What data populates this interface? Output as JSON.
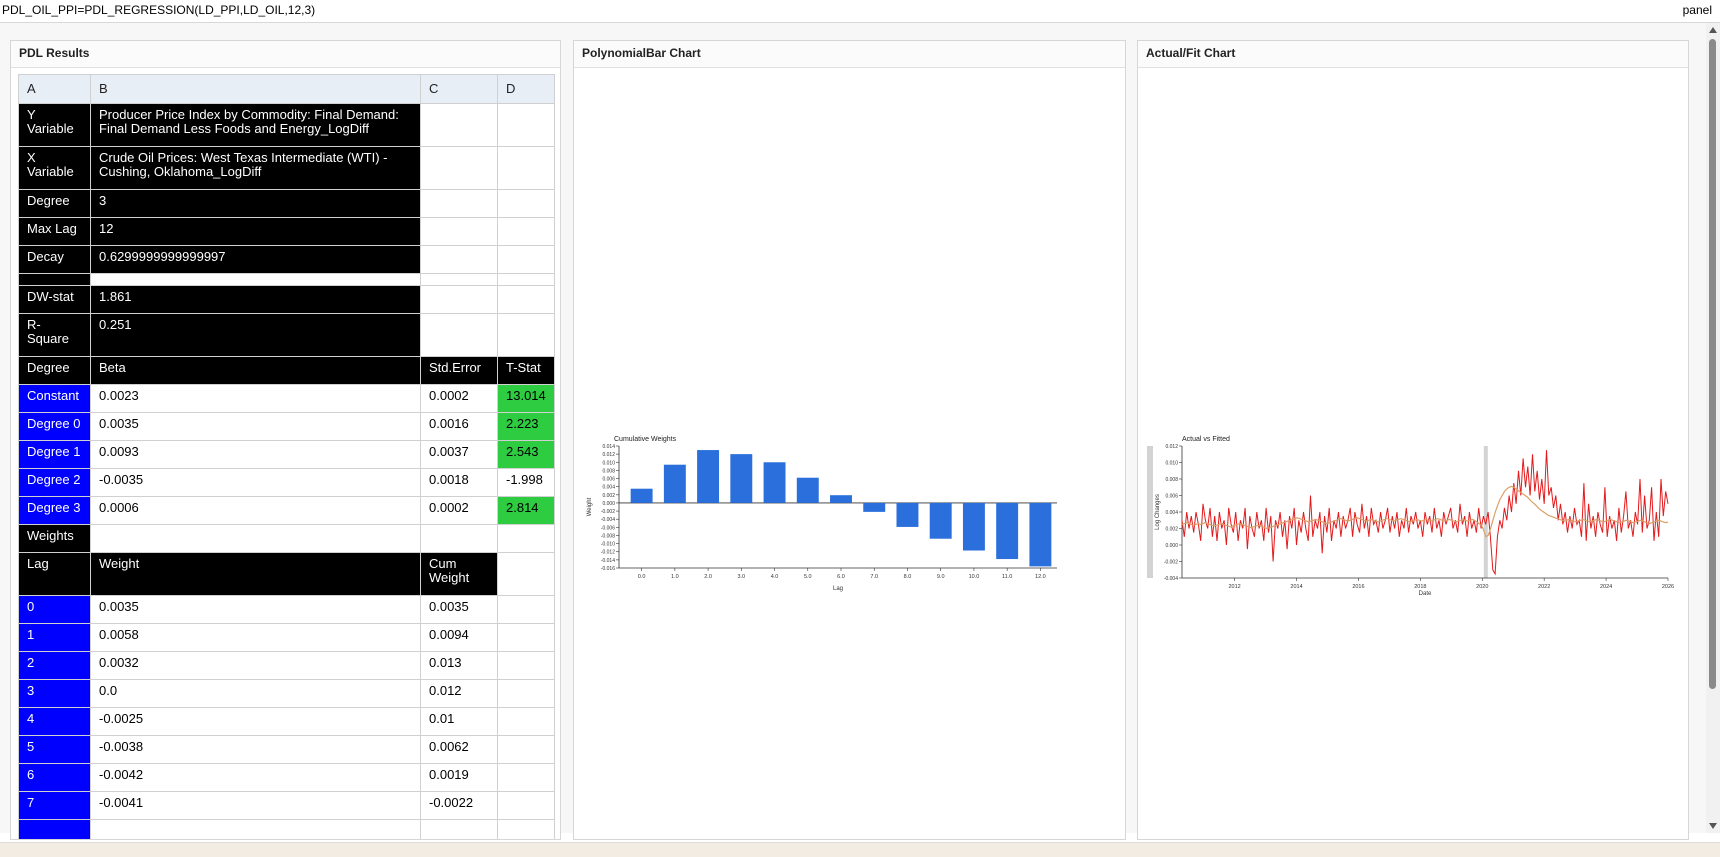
{
  "formula": "PDL_OIL_PPI=PDL_REGRESSION(LD_PPI,LD_OIL,12,3)",
  "panel_tag": "panel",
  "panels": {
    "results": "PDL Results",
    "poly": "PolynomialBar Chart",
    "fit": "Actual/Fit Chart"
  },
  "table": {
    "columns": [
      "A",
      "B",
      "C",
      "D"
    ],
    "y_variable": {
      "label": "Y Variable",
      "value": "Producer Price Index by Commodity: Final Demand: Final Demand Less Foods and Energy_LogDiff"
    },
    "x_variable": {
      "label": "X Variable",
      "value": "Crude Oil Prices: West Texas Intermediate (WTI) - Cushing, Oklahoma_LogDiff"
    },
    "degree": {
      "label": "Degree",
      "value": "3"
    },
    "max_lag": {
      "label": "Max Lag",
      "value": "12"
    },
    "decay": {
      "label": "Decay",
      "value": "0.6299999999999997"
    },
    "dw": {
      "label": "DW-stat",
      "value": "1.861"
    },
    "r2": {
      "label": "R-Square",
      "value": "0.251"
    },
    "coef_header": [
      "Degree",
      "Beta",
      "Std.Error",
      "T-Stat"
    ],
    "coefs": [
      {
        "name": "Constant",
        "beta": "0.0023",
        "se": "0.0002",
        "t": "13.014",
        "sig": true
      },
      {
        "name": "Degree 0",
        "beta": "0.0035",
        "se": "0.0016",
        "t": "2.223",
        "sig": true
      },
      {
        "name": "Degree 1",
        "beta": "0.0093",
        "se": "0.0037",
        "t": "2.543",
        "sig": true
      },
      {
        "name": "Degree 2",
        "beta": "-0.0035",
        "se": "0.0018",
        "t": "-1.998",
        "sig": false
      },
      {
        "name": "Degree 3",
        "beta": "0.0006",
        "se": "0.0002",
        "t": "2.814",
        "sig": true
      }
    ],
    "weights_label": "Weights",
    "weights_header": [
      "Lag",
      "Weight",
      "Cum Weight"
    ],
    "weights": [
      {
        "lag": "0",
        "w": "0.0035",
        "cum": "0.0035"
      },
      {
        "lag": "1",
        "w": "0.0058",
        "cum": "0.0094"
      },
      {
        "lag": "2",
        "w": "0.0032",
        "cum": "0.013"
      },
      {
        "lag": "3",
        "w": "0.0",
        "cum": "0.012"
      },
      {
        "lag": "4",
        "w": "-0.0025",
        "cum": "0.01"
      },
      {
        "lag": "5",
        "w": "-0.0038",
        "cum": "0.0062"
      },
      {
        "lag": "6",
        "w": "-0.0042",
        "cum": "0.0019"
      },
      {
        "lag": "7",
        "w": "-0.0041",
        "cum": "-0.0022"
      }
    ]
  },
  "colors": {
    "black": "#000000",
    "blue": "#0000ff",
    "green": "#2ecc40",
    "bar": "#2a6fdb",
    "actual": "#e31a1c",
    "fitted": "#d9a066"
  },
  "chart_data": [
    {
      "type": "bar",
      "title": "Cumulative Weights",
      "xlabel": "Lag",
      "ylabel": "Weight",
      "categories": [
        "0.0",
        "1.0",
        "2.0",
        "3.0",
        "4.0",
        "5.0",
        "6.0",
        "7.0",
        "8.0",
        "9.0",
        "10.0",
        "11.0",
        "12.0"
      ],
      "values": [
        0.0035,
        0.0094,
        0.013,
        0.012,
        0.01,
        0.0062,
        0.0019,
        -0.0022,
        -0.0059,
        -0.0088,
        -0.0117,
        -0.0138,
        -0.0156
      ],
      "ylim": [
        -0.016,
        0.014
      ],
      "yticks": [
        "0.014",
        "0.012",
        "0.010",
        "0.008",
        "0.006",
        "0.004",
        "0.002",
        "0.000",
        "-0.002",
        "-0.004",
        "-0.006",
        "-0.008",
        "-0.010",
        "-0.012",
        "-0.014",
        "-0.016"
      ]
    },
    {
      "type": "line",
      "title": "Actual vs Fitted",
      "xlabel": "Date",
      "ylabel": "Log Changes",
      "xlim": [
        2010.3,
        2026
      ],
      "ylim": [
        -0.004,
        0.012
      ],
      "xticks": [
        "2012",
        "2014",
        "2016",
        "2018",
        "2020",
        "2022",
        "2024",
        "2026"
      ],
      "yticks": [
        "0.012",
        "0.010",
        "0.008",
        "0.006",
        "0.004",
        "0.002",
        "0.000",
        "-0.002",
        "-0.004"
      ],
      "series": [
        {
          "name": "Actual",
          "values": [
            0.003,
            0.001,
            0.004,
            0.002,
            0.0035,
            0.0015,
            0.004,
            0.0025,
            0.0005,
            0.005,
            0.003,
            0.002,
            0.0045,
            0.001,
            0.0035,
            0.0005,
            0.004,
            0.002,
            0.003,
            0.0,
            0.0045,
            0.0025,
            0.0015,
            0.004,
            0.0005,
            0.003,
            0.002,
            0.0045,
            -0.0005,
            0.0035,
            0.002,
            0.001,
            0.004,
            0.002,
            0.003,
            0.0005,
            0.0045,
            0.0015,
            0.0035,
            -0.002,
            0.003,
            0.002,
            0.004,
            0.001,
            0.003,
            -0.0005,
            0.0035,
            0.002,
            0.0045,
            0.0,
            0.003,
            0.0015,
            0.004,
            0.002,
            0.0005,
            0.006,
            0.001,
            0.003,
            0.002,
            0.004,
            -0.001,
            0.0035,
            0.0015,
            0.0045,
            0.0005,
            0.003,
            0.002,
            0.004,
            0.001,
            0.0035,
            0.002,
            0.003,
            0.0045,
            0.001,
            0.004,
            0.0025,
            0.0015,
            0.005,
            0.002,
            0.0035,
            0.001,
            0.0045,
            0.0025,
            0.003,
            0.0015,
            0.004,
            0.002,
            0.003,
            0.0045,
            0.0015,
            0.0035,
            0.002,
            0.004,
            0.001,
            0.003,
            0.002,
            0.0045,
            0.0015,
            0.0035,
            0.0025,
            0.004,
            0.002,
            0.003,
            0.001,
            0.004,
            0.0025,
            0.0035,
            0.0015,
            0.0045,
            0.002,
            0.003,
            0.001,
            0.004,
            0.0025,
            0.0035,
            0.0045,
            0.002,
            0.003,
            0.0015,
            0.005,
            0.0025,
            0.0035,
            0.001,
            0.004,
            0.002,
            0.003,
            0.0015,
            0.0045,
            0.002,
            0.0035,
            0.0025,
            0.004,
            0.001,
            -0.003,
            -0.0035,
            0.001,
            0.003,
            0.002,
            0.0045,
            0.003,
            0.006,
            0.004,
            0.0075,
            0.005,
            0.009,
            0.006,
            0.0105,
            0.007,
            0.0095,
            0.006,
            0.011,
            0.0065,
            0.009,
            0.0055,
            0.008,
            0.005,
            0.0115,
            0.006,
            0.007,
            0.0045,
            0.006,
            0.003,
            0.005,
            0.0025,
            0.004,
            0.0015,
            0.0035,
            0.002,
            0.0045,
            0.0025,
            0.003,
            0.001,
            0.0075,
            0.0005,
            0.005,
            0.002,
            0.0035,
            0.001,
            0.004,
            0.0025,
            0.0015,
            0.007,
            0.001,
            0.0035,
            0.002,
            0.003,
            0.0005,
            0.0045,
            0.0015,
            0.0035,
            0.0065,
            0.002,
            0.003,
            0.001,
            0.004,
            0.0025,
            0.008,
            0.0015,
            0.006,
            0.002,
            0.003,
            0.007,
            0.0005,
            0.004,
            0.001,
            0.008,
            0.0035,
            0.0065,
            0.005
          ]
        },
        {
          "name": "Fitted",
          "values": [
            0.0025,
            0.0026,
            0.0027,
            0.0026,
            0.0025,
            0.0024,
            0.0025,
            0.0026,
            0.0025,
            0.0026,
            0.0027,
            0.0026,
            0.0025,
            0.0024,
            0.0023,
            0.0024,
            0.0025,
            0.0026,
            0.0025,
            0.0024,
            0.0023,
            0.0022,
            0.0023,
            0.0024,
            0.0025,
            0.0026,
            0.0025,
            0.0024,
            0.0023,
            0.0022,
            0.0021,
            0.0022,
            0.0023,
            0.0024,
            0.0023,
            0.0022,
            0.0021,
            0.002,
            0.0021,
            0.0022,
            0.0023,
            0.0024,
            0.0025,
            0.0026,
            0.0027,
            0.0028,
            0.0029,
            0.003,
            0.0031,
            0.0032,
            0.0033,
            0.0032,
            0.0031,
            0.003,
            0.0029,
            0.0028,
            0.0029,
            0.003,
            0.0031,
            0.003,
            0.0029,
            0.0028,
            0.0027,
            0.0026,
            0.0027,
            0.0028,
            0.0029,
            0.003,
            0.0031,
            0.0032,
            0.0031,
            0.003,
            0.0029,
            0.003,
            0.0031,
            0.0032,
            0.0033,
            0.0032,
            0.0031,
            0.003,
            0.0029,
            0.003,
            0.0031,
            0.003,
            0.0029,
            0.0028,
            0.0029,
            0.003,
            0.0031,
            0.0032,
            0.0031,
            0.003,
            0.0029,
            0.003,
            0.0031,
            0.0032,
            0.0031,
            0.003,
            0.0029,
            0.0028,
            0.0029,
            0.003,
            0.0031,
            0.003,
            0.0029,
            0.003,
            0.0031,
            0.003,
            0.0029,
            0.003,
            0.0031,
            0.0032,
            0.0031,
            0.003,
            0.0029,
            0.003,
            0.0031,
            0.003,
            0.0029,
            0.0028,
            0.0029,
            0.003,
            0.0031,
            0.003,
            0.0029,
            0.003,
            0.0031,
            0.003,
            0.0028,
            0.0026,
            0.0024,
            0.0018,
            0.001,
            0.0012,
            0.002,
            0.003,
            0.004,
            0.0048,
            0.0055,
            0.006,
            0.0065,
            0.0068,
            0.007,
            0.0071,
            0.007,
            0.0068,
            0.0066,
            0.0064,
            0.0062,
            0.006,
            0.0058,
            0.0055,
            0.0052,
            0.005,
            0.0047,
            0.0044,
            0.0042,
            0.004,
            0.0038,
            0.0036,
            0.0035,
            0.0034,
            0.0033,
            0.0032,
            0.0031,
            0.003,
            0.0029,
            0.003,
            0.0031,
            0.003,
            0.0029,
            0.0028,
            0.0029,
            0.003,
            0.0031,
            0.003,
            0.0029,
            0.0028,
            0.0029,
            0.003,
            0.0031,
            0.003,
            0.0029,
            0.0028,
            0.0029,
            0.003,
            0.0031,
            0.003,
            0.0029,
            0.0028,
            0.0027,
            0.0028,
            0.0029,
            0.003,
            0.0029,
            0.0028,
            0.0027,
            0.0028,
            0.0029,
            0.003,
            0.0029,
            0.0028,
            0.0027,
            0.0026,
            0.0027,
            0.0028,
            0.0029,
            0.003,
            0.0029,
            0.0028,
            0.0027,
            0.0028
          ]
        }
      ]
    }
  ]
}
